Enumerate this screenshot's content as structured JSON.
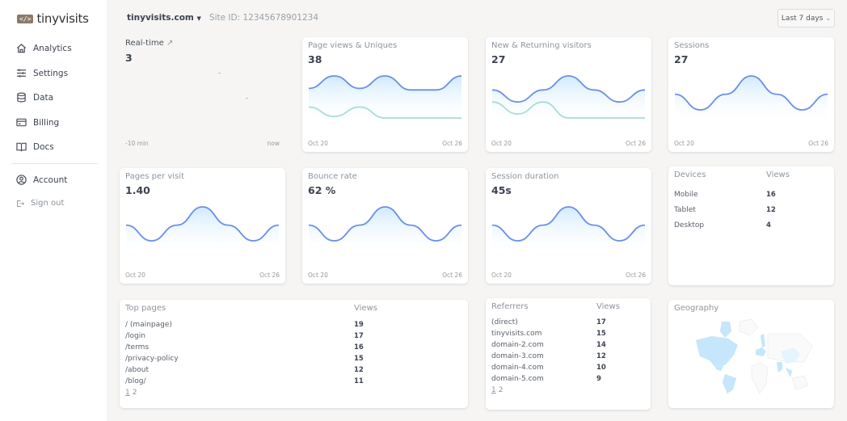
{
  "brand": {
    "logo_badge": "</>",
    "name": "tinyvisits"
  },
  "sidebar": {
    "items": [
      {
        "label": "Analytics",
        "icon": "home-icon"
      },
      {
        "label": "Settings",
        "icon": "sliders-icon"
      },
      {
        "label": "Data",
        "icon": "database-icon"
      },
      {
        "label": "Billing",
        "icon": "credit-card-icon"
      },
      {
        "label": "Docs",
        "icon": "book-icon"
      }
    ],
    "account": "Account",
    "signout": "Sign out"
  },
  "header": {
    "site": "tinyvisits.com",
    "site_id_label": "Site ID:",
    "site_id": "12345678901234",
    "range": "Last 7 days"
  },
  "realtime": {
    "title": "Real-time",
    "value": "3",
    "from": "-10 min",
    "to": "now"
  },
  "dates": {
    "start": "Oct 20",
    "end": "Oct 26"
  },
  "colors": {
    "primary": "#6a8fe8",
    "secondary": "#a7dcd8",
    "fill": "#cfeaff"
  },
  "cards": [
    {
      "title": "Page views & Uniques",
      "value": "38",
      "series": [
        [
          30,
          38,
          30,
          38,
          29,
          29,
          38
        ],
        [
          18,
          12,
          18,
          11,
          11,
          11,
          11
        ]
      ]
    },
    {
      "title": "New & Returning visitors",
      "value": "27",
      "series": [
        [
          20,
          14,
          20,
          27,
          20,
          14,
          20
        ],
        [
          14,
          8,
          14,
          6,
          6,
          6,
          6
        ]
      ]
    },
    {
      "title": "Sessions",
      "value": "27",
      "series": [
        [
          20,
          14,
          20,
          27,
          20,
          14,
          20
        ]
      ]
    },
    {
      "title": "Pages per visit",
      "value": "1.40",
      "series": [
        [
          20,
          14,
          20,
          27,
          20,
          14,
          20
        ]
      ]
    },
    {
      "title": "Bounce rate",
      "value": "62 %",
      "series": [
        [
          20,
          14,
          20,
          27,
          20,
          14,
          20
        ]
      ]
    },
    {
      "title": "Session duration",
      "value": "45s",
      "series": [
        [
          20,
          14,
          20,
          27,
          20,
          14,
          20
        ]
      ]
    }
  ],
  "devices": {
    "title": "Devices",
    "views": "Views",
    "rows": [
      {
        "name": "Mobile",
        "views": "16"
      },
      {
        "name": "Tablet",
        "views": "12"
      },
      {
        "name": "Desktop",
        "views": "4"
      }
    ]
  },
  "top_pages": {
    "title": "Top pages",
    "views": "Views",
    "rows": [
      {
        "name": "/ (mainpage)",
        "views": "19"
      },
      {
        "name": "/login",
        "views": "17"
      },
      {
        "name": "/terms",
        "views": "16"
      },
      {
        "name": "/privacy-policy",
        "views": "15"
      },
      {
        "name": "/about",
        "views": "12"
      },
      {
        "name": "/blog/",
        "views": "11"
      }
    ],
    "pages": [
      "1",
      "2"
    ]
  },
  "referrers": {
    "title": "Referrers",
    "views": "Views",
    "rows": [
      {
        "name": "(direct)",
        "views": "17"
      },
      {
        "name": "tinyvisits.com",
        "views": "15"
      },
      {
        "name": "domain-2.com",
        "views": "14"
      },
      {
        "name": "domain-3.com",
        "views": "12"
      },
      {
        "name": "domain-4.com",
        "views": "10"
      },
      {
        "name": "domain-5.com",
        "views": "9"
      }
    ],
    "pages": [
      "1",
      "2"
    ]
  },
  "geography": {
    "title": "Geography"
  }
}
